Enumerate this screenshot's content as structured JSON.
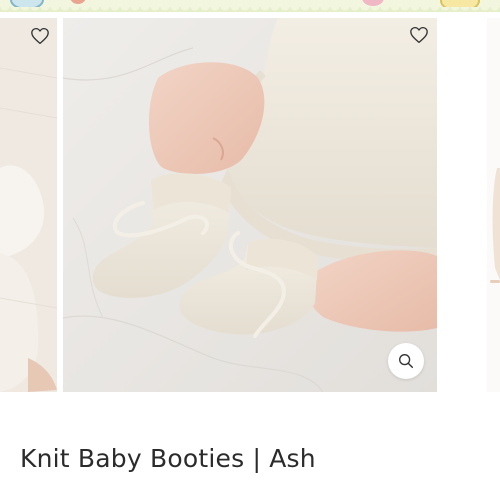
{
  "product": {
    "title": "Knit Baby Booties | Ash"
  },
  "gallery": {
    "slides": [
      {
        "id": "left",
        "favorite_icon": "heart-outline-icon"
      },
      {
        "id": "main",
        "favorite_icon": "heart-outline-icon",
        "zoom_icon": "magnifier-icon"
      },
      {
        "id": "right"
      }
    ]
  },
  "colors": {
    "title_text": "#2b2b2b",
    "banner_bg": "#f3f6df",
    "banner_wave": "#e4efc9",
    "icon_stroke": "#333333"
  }
}
